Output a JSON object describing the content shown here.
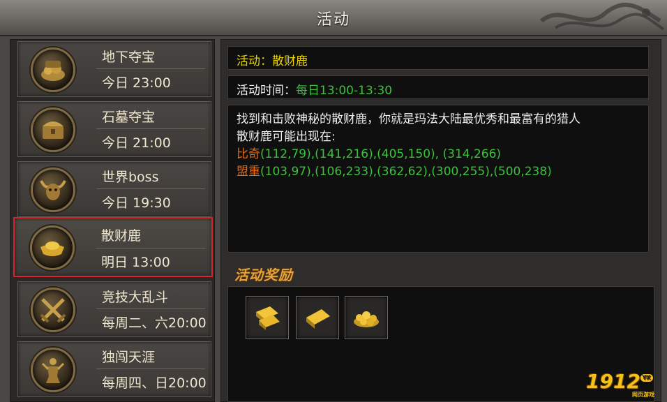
{
  "window": {
    "title": "活动"
  },
  "activities": [
    {
      "name": "地下夺宝",
      "time": "今日 23:00",
      "icon": "treasure-pile-icon"
    },
    {
      "name": "石墓夺宝",
      "time": "今日 21:00",
      "icon": "treasure-chest-icon"
    },
    {
      "name": "世界boss",
      "time": "今日 19:30",
      "icon": "bull-demon-icon"
    },
    {
      "name": "散财鹿",
      "time": "明日 13:00",
      "icon": "gold-ingot-icon",
      "selected": true
    },
    {
      "name": "竞技大乱斗",
      "time": "每周二、六20:00",
      "icon": "crossed-swords-icon"
    },
    {
      "name": "独闯天涯",
      "time": "每周四、日20:00",
      "icon": "warrior-statue-icon"
    }
  ],
  "detail": {
    "activity_label": "活动：散财鹿",
    "time_prefix": "活动时间：",
    "time_value": "每日13:00-13:30",
    "description": "找到和击败神秘的散财鹿，你就是玛法大陆最优秀和最富有的猎人",
    "appear_label": "散财鹿可能出现在:",
    "locations": [
      {
        "map": "比奇",
        "coords": "(112,79),(141,216),(405,150), (314,266)"
      },
      {
        "map": "盟重",
        "coords": "(103,97),(106,233),(362,62),(300,255),(500,238)"
      }
    ]
  },
  "rewards": {
    "title": "活动奖励",
    "items": [
      {
        "icon": "gold-bars-icon"
      },
      {
        "icon": "gold-bar-icon"
      },
      {
        "icon": "gold-coins-pile-icon"
      }
    ]
  },
  "watermark": {
    "text": "1912",
    "badge": "YX",
    "sub": "网页游戏"
  },
  "colors": {
    "highlight_border": "#d7262b",
    "yellow_text": "#e8d300",
    "green_text": "#3cc13c",
    "orange_text": "#e46a10",
    "reward_title": "#e4a43a"
  }
}
